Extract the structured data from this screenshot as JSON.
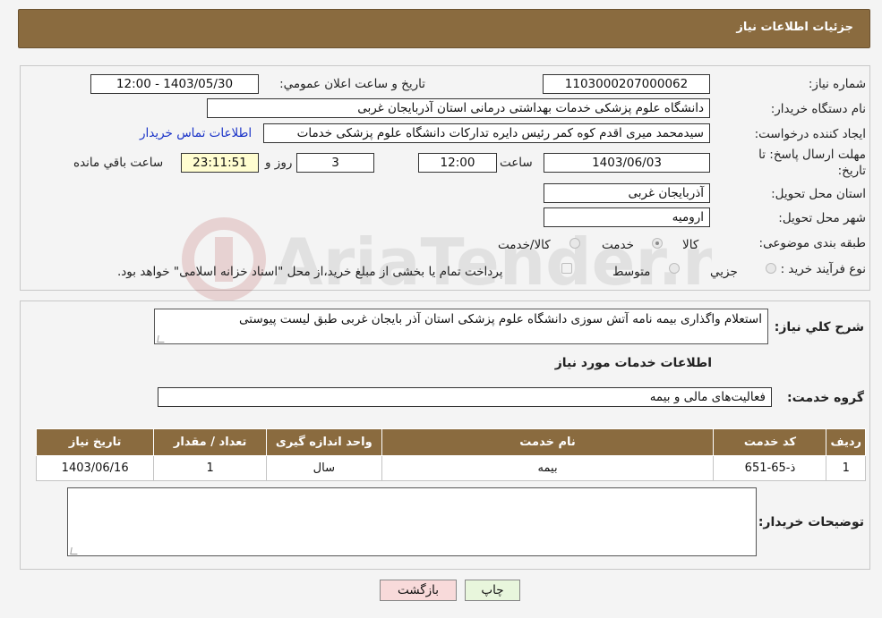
{
  "header": {
    "title": "جزئیات اطلاعات نیاز"
  },
  "fields": {
    "need_number_label": "شماره نیاز:",
    "need_number": "1103000207000062",
    "announce_label": "تاریخ و ساعت اعلان عمومي:",
    "announce_value": "1403/05/30 - 12:00",
    "buyer_org_label": "نام دستگاه خريدار:",
    "buyer_org": "دانشگاه علوم پزشکی خدمات بهداشتی درمانی استان آذربایجان غربی",
    "creator_label": "ايجاد كننده درخواست:",
    "creator": "سیدمحمد میری اقدم کوه کمر رئیس دایره تدارکات دانشگاه علوم پزشکی خدمات",
    "contact_link": "اطلاعات تماس خريدار",
    "deadline_label_1": "مهلت ارسال پاسخ: تا",
    "deadline_label_2": "تاريخ:",
    "deadline_date": "1403/06/03",
    "time_label": "ساعت",
    "deadline_time": "12:00",
    "days_value": "3",
    "days_label": "روز و",
    "remaining_time": "23:11:51",
    "remaining_label": "ساعت باقي مانده",
    "province_label": "استان محل تحویل:",
    "province": "آذربایجان غربی",
    "city_label": "شهر محل تحویل:",
    "city": "ارومیه",
    "category_label": "طبقه بندی موضوعی:",
    "category_options": [
      "کالا",
      "خدمت",
      "کالا/خدمت"
    ],
    "process_label": "نوع فرآيند خريد :",
    "process_options": [
      "جزيي",
      "متوسط"
    ],
    "payment_note": "پرداخت تمام یا بخشی از مبلغ خرید،از محل \"اسناد خزانه اسلامی\" خواهد بود."
  },
  "summary": {
    "label": "شرح کلي نياز:",
    "value": "استعلام واگذاری بیمه نامه آتش سوزی دانشگاه علوم پزشکی استان آذر بایجان غربی طبق لیست پیوستی",
    "services_heading": "اطلاعات خدمات مورد نياز",
    "group_label": "گروه خدمت:",
    "group_value": "فعالیت‌های مالی و بیمه"
  },
  "table": {
    "headers": [
      "رديف",
      "كد خدمت",
      "نام خدمت",
      "واحد اندازه گيری",
      "تعداد / مقدار",
      "تاريخ نياز"
    ],
    "rows": [
      [
        "1",
        "ذ-65-651",
        "بیمه",
        "سال",
        "1",
        "1403/06/16"
      ]
    ]
  },
  "buyer_notes_label": "توضيحات خريدار:",
  "buttons": {
    "print": "چاپ",
    "back": "بازگشت"
  },
  "watermark": {
    "text": "AriaTender.neT"
  },
  "colors": {
    "header_bg": "#8a6b3f",
    "link": "#1a33c8",
    "back_button_bg": "#f8dada",
    "print_button_bg": "#e8f6dc"
  }
}
